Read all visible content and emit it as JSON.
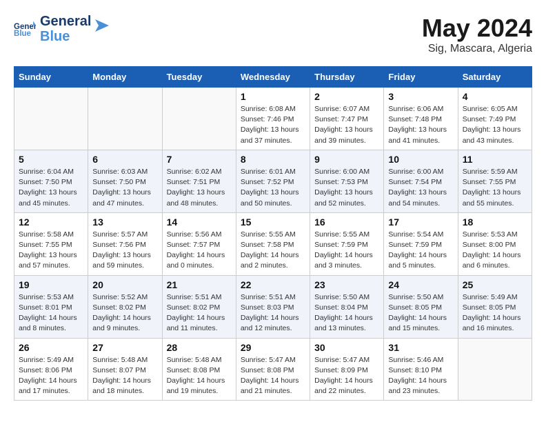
{
  "header": {
    "logo_general": "General",
    "logo_blue": "Blue",
    "month_title": "May 2024",
    "location": "Sig, Mascara, Algeria"
  },
  "weekdays": [
    "Sunday",
    "Monday",
    "Tuesday",
    "Wednesday",
    "Thursday",
    "Friday",
    "Saturday"
  ],
  "weeks": [
    {
      "alt": false,
      "days": [
        {
          "number": "",
          "info": ""
        },
        {
          "number": "",
          "info": ""
        },
        {
          "number": "",
          "info": ""
        },
        {
          "number": "1",
          "info": "Sunrise: 6:08 AM\nSunset: 7:46 PM\nDaylight: 13 hours\nand 37 minutes."
        },
        {
          "number": "2",
          "info": "Sunrise: 6:07 AM\nSunset: 7:47 PM\nDaylight: 13 hours\nand 39 minutes."
        },
        {
          "number": "3",
          "info": "Sunrise: 6:06 AM\nSunset: 7:48 PM\nDaylight: 13 hours\nand 41 minutes."
        },
        {
          "number": "4",
          "info": "Sunrise: 6:05 AM\nSunset: 7:49 PM\nDaylight: 13 hours\nand 43 minutes."
        }
      ]
    },
    {
      "alt": true,
      "days": [
        {
          "number": "5",
          "info": "Sunrise: 6:04 AM\nSunset: 7:50 PM\nDaylight: 13 hours\nand 45 minutes."
        },
        {
          "number": "6",
          "info": "Sunrise: 6:03 AM\nSunset: 7:50 PM\nDaylight: 13 hours\nand 47 minutes."
        },
        {
          "number": "7",
          "info": "Sunrise: 6:02 AM\nSunset: 7:51 PM\nDaylight: 13 hours\nand 48 minutes."
        },
        {
          "number": "8",
          "info": "Sunrise: 6:01 AM\nSunset: 7:52 PM\nDaylight: 13 hours\nand 50 minutes."
        },
        {
          "number": "9",
          "info": "Sunrise: 6:00 AM\nSunset: 7:53 PM\nDaylight: 13 hours\nand 52 minutes."
        },
        {
          "number": "10",
          "info": "Sunrise: 6:00 AM\nSunset: 7:54 PM\nDaylight: 13 hours\nand 54 minutes."
        },
        {
          "number": "11",
          "info": "Sunrise: 5:59 AM\nSunset: 7:55 PM\nDaylight: 13 hours\nand 55 minutes."
        }
      ]
    },
    {
      "alt": false,
      "days": [
        {
          "number": "12",
          "info": "Sunrise: 5:58 AM\nSunset: 7:55 PM\nDaylight: 13 hours\nand 57 minutes."
        },
        {
          "number": "13",
          "info": "Sunrise: 5:57 AM\nSunset: 7:56 PM\nDaylight: 13 hours\nand 59 minutes."
        },
        {
          "number": "14",
          "info": "Sunrise: 5:56 AM\nSunset: 7:57 PM\nDaylight: 14 hours\nand 0 minutes."
        },
        {
          "number": "15",
          "info": "Sunrise: 5:55 AM\nSunset: 7:58 PM\nDaylight: 14 hours\nand 2 minutes."
        },
        {
          "number": "16",
          "info": "Sunrise: 5:55 AM\nSunset: 7:59 PM\nDaylight: 14 hours\nand 3 minutes."
        },
        {
          "number": "17",
          "info": "Sunrise: 5:54 AM\nSunset: 7:59 PM\nDaylight: 14 hours\nand 5 minutes."
        },
        {
          "number": "18",
          "info": "Sunrise: 5:53 AM\nSunset: 8:00 PM\nDaylight: 14 hours\nand 6 minutes."
        }
      ]
    },
    {
      "alt": true,
      "days": [
        {
          "number": "19",
          "info": "Sunrise: 5:53 AM\nSunset: 8:01 PM\nDaylight: 14 hours\nand 8 minutes."
        },
        {
          "number": "20",
          "info": "Sunrise: 5:52 AM\nSunset: 8:02 PM\nDaylight: 14 hours\nand 9 minutes."
        },
        {
          "number": "21",
          "info": "Sunrise: 5:51 AM\nSunset: 8:02 PM\nDaylight: 14 hours\nand 11 minutes."
        },
        {
          "number": "22",
          "info": "Sunrise: 5:51 AM\nSunset: 8:03 PM\nDaylight: 14 hours\nand 12 minutes."
        },
        {
          "number": "23",
          "info": "Sunrise: 5:50 AM\nSunset: 8:04 PM\nDaylight: 14 hours\nand 13 minutes."
        },
        {
          "number": "24",
          "info": "Sunrise: 5:50 AM\nSunset: 8:05 PM\nDaylight: 14 hours\nand 15 minutes."
        },
        {
          "number": "25",
          "info": "Sunrise: 5:49 AM\nSunset: 8:05 PM\nDaylight: 14 hours\nand 16 minutes."
        }
      ]
    },
    {
      "alt": false,
      "days": [
        {
          "number": "26",
          "info": "Sunrise: 5:49 AM\nSunset: 8:06 PM\nDaylight: 14 hours\nand 17 minutes."
        },
        {
          "number": "27",
          "info": "Sunrise: 5:48 AM\nSunset: 8:07 PM\nDaylight: 14 hours\nand 18 minutes."
        },
        {
          "number": "28",
          "info": "Sunrise: 5:48 AM\nSunset: 8:08 PM\nDaylight: 14 hours\nand 19 minutes."
        },
        {
          "number": "29",
          "info": "Sunrise: 5:47 AM\nSunset: 8:08 PM\nDaylight: 14 hours\nand 21 minutes."
        },
        {
          "number": "30",
          "info": "Sunrise: 5:47 AM\nSunset: 8:09 PM\nDaylight: 14 hours\nand 22 minutes."
        },
        {
          "number": "31",
          "info": "Sunrise: 5:46 AM\nSunset: 8:10 PM\nDaylight: 14 hours\nand 23 minutes."
        },
        {
          "number": "",
          "info": ""
        }
      ]
    }
  ]
}
